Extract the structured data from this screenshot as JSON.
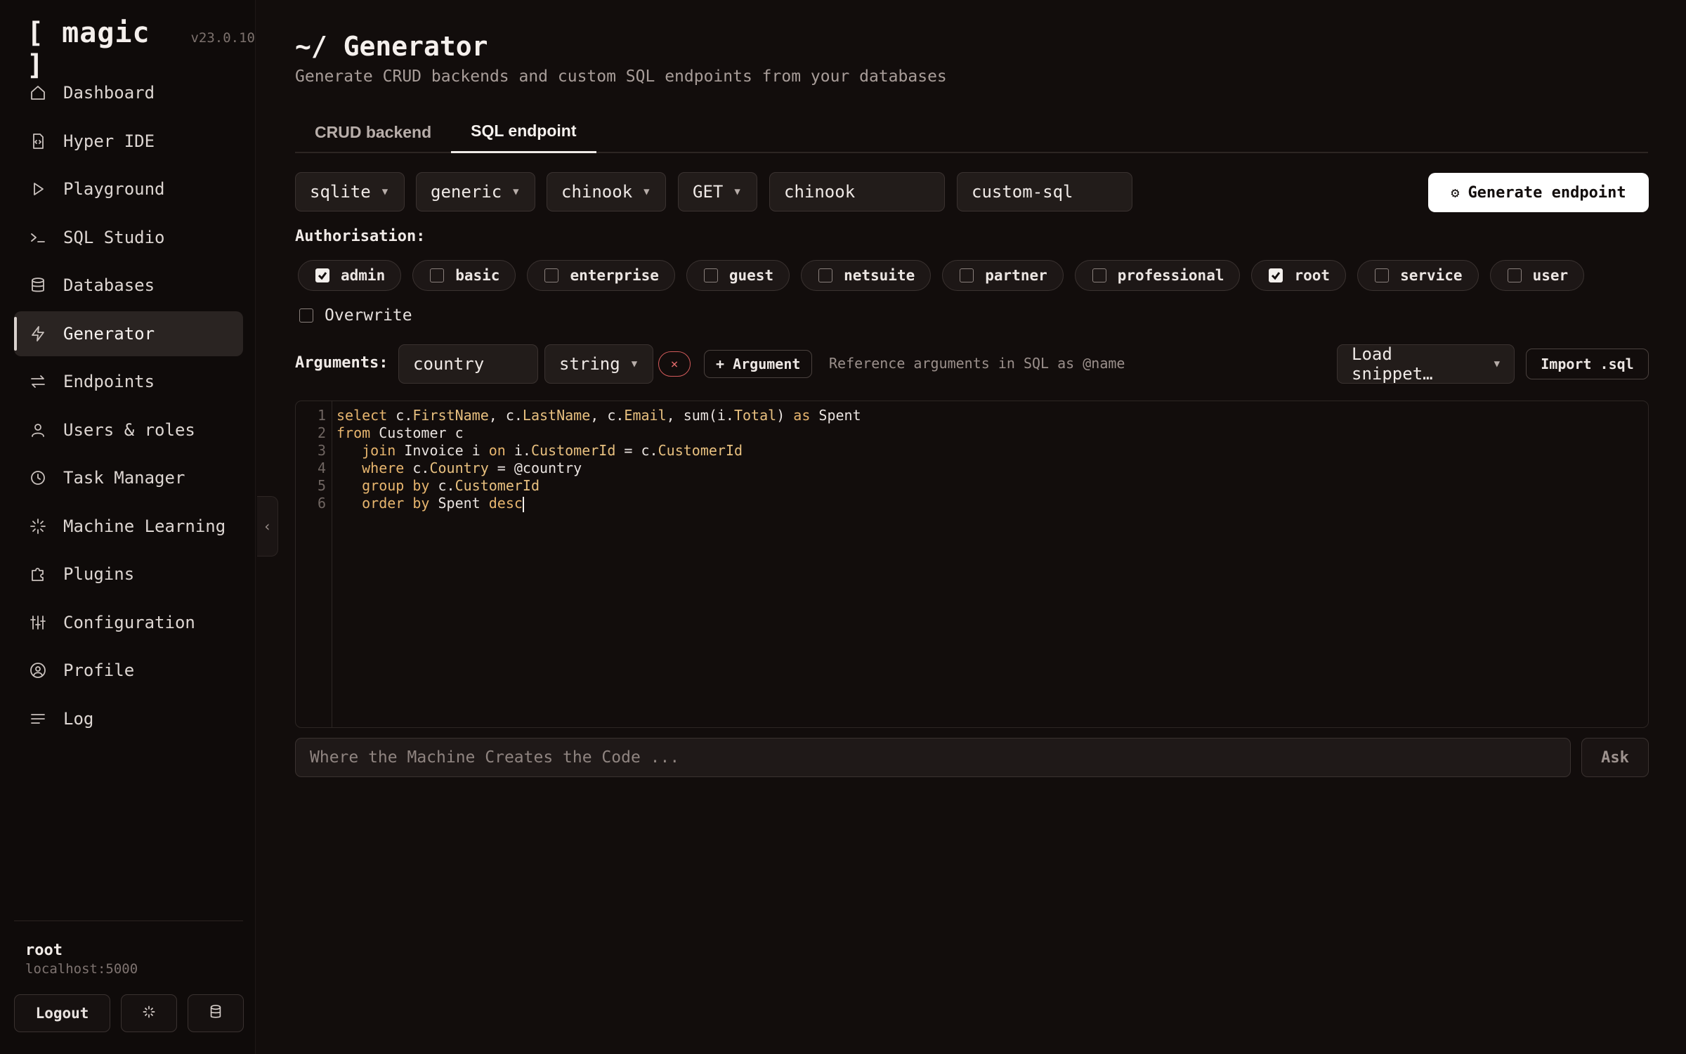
{
  "app": {
    "logo": "[ magic ]",
    "version": "v23.0.10"
  },
  "sidebar": {
    "items": [
      {
        "label": "Dashboard",
        "icon": "home-icon"
      },
      {
        "label": "Hyper IDE",
        "icon": "code-file-icon"
      },
      {
        "label": "Playground",
        "icon": "play-icon"
      },
      {
        "label": "SQL Studio",
        "icon": "terminal-icon"
      },
      {
        "label": "Databases",
        "icon": "database-icon"
      },
      {
        "label": "Generator",
        "icon": "bolt-icon",
        "active": true
      },
      {
        "label": "Endpoints",
        "icon": "arrows-icon"
      },
      {
        "label": "Users & roles",
        "icon": "user-icon"
      },
      {
        "label": "Task Manager",
        "icon": "clock-icon"
      },
      {
        "label": "Machine Learning",
        "icon": "sparkle-icon"
      },
      {
        "label": "Plugins",
        "icon": "puzzle-icon"
      },
      {
        "label": "Configuration",
        "icon": "sliders-icon"
      },
      {
        "label": "Profile",
        "icon": "profile-icon"
      },
      {
        "label": "Log",
        "icon": "log-icon"
      }
    ],
    "user": {
      "name": "root",
      "host": "localhost:5000"
    },
    "logout_label": "Logout"
  },
  "header": {
    "title": "~/ Generator",
    "subtitle": "Generate CRUD backends and custom SQL endpoints from your databases"
  },
  "tabs": [
    {
      "label": "CRUD backend",
      "active": false
    },
    {
      "label": "SQL endpoint",
      "active": true
    }
  ],
  "toolbar": {
    "db_type": "sqlite",
    "connection": "generic",
    "database": "chinook",
    "verb": "GET",
    "module": "chinook",
    "endpoint": "custom-sql",
    "generate_label": "Generate endpoint"
  },
  "auth": {
    "label": "Authorisation:",
    "roles": [
      {
        "name": "admin",
        "checked": true
      },
      {
        "name": "basic",
        "checked": false
      },
      {
        "name": "enterprise",
        "checked": false
      },
      {
        "name": "guest",
        "checked": false
      },
      {
        "name": "netsuite",
        "checked": false
      },
      {
        "name": "partner",
        "checked": false
      },
      {
        "name": "professional",
        "checked": false
      },
      {
        "name": "root",
        "checked": true
      },
      {
        "name": "service",
        "checked": false
      },
      {
        "name": "user",
        "checked": false
      }
    ]
  },
  "overwrite": {
    "label": "Overwrite",
    "checked": false
  },
  "arguments": {
    "label": "Arguments:",
    "name": "country",
    "type": "string",
    "remove_label": "×",
    "add_label": "+ Argument",
    "hint": "Reference arguments in SQL as @name",
    "snippet_label": "Load snippet…",
    "import_label": "Import .sql"
  },
  "editor": {
    "line_numbers": [
      "1",
      "2",
      "3",
      "4",
      "5",
      "6"
    ]
  },
  "ai": {
    "placeholder": "Where the Machine Creates the Code ...",
    "ask_label": "Ask"
  }
}
